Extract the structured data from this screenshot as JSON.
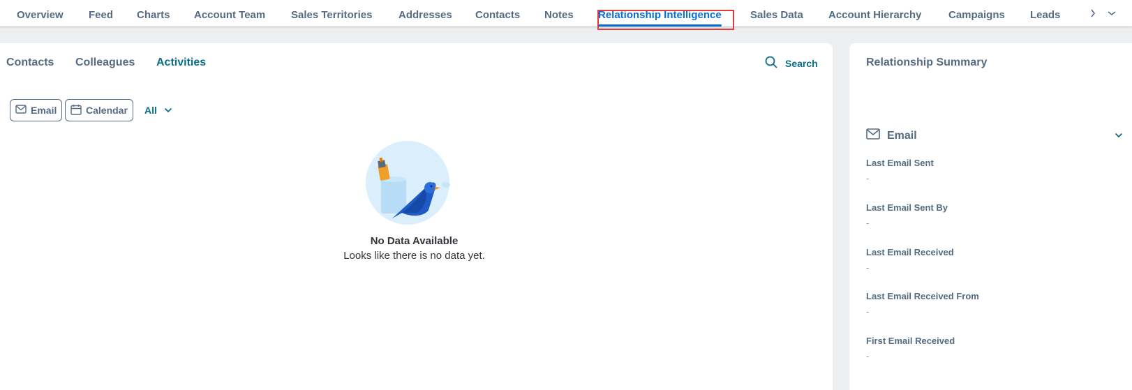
{
  "tabs": [
    {
      "label": "Overview"
    },
    {
      "label": "Feed"
    },
    {
      "label": "Charts"
    },
    {
      "label": "Account Team"
    },
    {
      "label": "Sales Territories"
    },
    {
      "label": "Addresses"
    },
    {
      "label": "Contacts"
    },
    {
      "label": "Notes"
    },
    {
      "label": "Relationship Intelligence"
    },
    {
      "label": "Sales Data"
    },
    {
      "label": "Account Hierarchy"
    },
    {
      "label": "Campaigns"
    },
    {
      "label": "Leads"
    }
  ],
  "selected_tab": "Relationship Intelligence",
  "subtabs": [
    {
      "label": "Contacts"
    },
    {
      "label": "Colleagues"
    },
    {
      "label": "Activities"
    }
  ],
  "active_subtab": "Activities",
  "search": {
    "label": "Search"
  },
  "filters": {
    "email_chip": "Email",
    "calendar_chip": "Calendar",
    "dropdown_value": "All"
  },
  "empty_state": {
    "title": "No Data Available",
    "subtitle": "Looks like there is no data yet."
  },
  "summary": {
    "title": "Relationship Summary",
    "section": "Email",
    "fields": [
      {
        "label": "Last Email Sent",
        "value": "-"
      },
      {
        "label": "Last Email Sent By",
        "value": "-"
      },
      {
        "label": "Last Email Received",
        "value": "-"
      },
      {
        "label": "Last Email Received From",
        "value": "-"
      },
      {
        "label": "First Email Received",
        "value": "-"
      }
    ]
  },
  "colors": {
    "accent": "#0a6ed1",
    "link": "#0a6e8a",
    "highlight_box": "#e03a3a",
    "text_muted": "#556b82"
  },
  "icons": [
    "search-icon",
    "mail-icon",
    "calendar-icon",
    "chevron-down-icon",
    "chevron-right-icon"
  ]
}
